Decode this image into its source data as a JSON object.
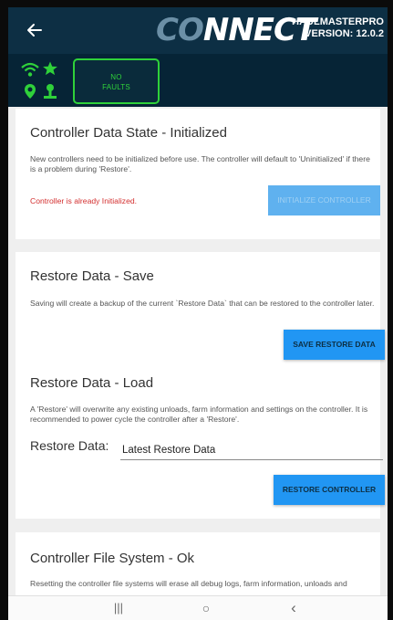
{
  "appbar": {
    "back_icon": "arrow-left-icon",
    "logo_prefix": "CO",
    "logo_suffix": "NNECT",
    "device_name": "HAULMASTERPRO",
    "version": "VERSION: 12.0.2"
  },
  "status": {
    "icons": [
      "wifi-icon",
      "star-icon",
      "location-pin-icon",
      "person-pin-icon"
    ],
    "faults_line1": "NO",
    "faults_line2": "FAULTS",
    "faults_color": "#2fd13a"
  },
  "controller_state": {
    "title": "Controller Data State - Initialized",
    "description": "New controllers need to be initialized before use. The controller will default to 'Uninitialized' if there is a problem during 'Restore'.",
    "warning": "Controller is already Initialized.",
    "button_label": "INITIALIZE CONTROLLER"
  },
  "restore_save": {
    "title": "Restore Data - Save",
    "description": "Saving will create a backup of the current `Restore Data` that can be restored to the controller later.",
    "button_label": "SAVE RESTORE DATA"
  },
  "restore_load": {
    "title": "Restore Data - Load",
    "description": "A 'Restore' will overwrite any existing unloads, farm information and settings on the controller. It is recommended to power cycle the controller after a 'Restore'.",
    "field_label": "Restore Data:",
    "field_value": "Latest Restore Data",
    "button_label": "RESTORE CONTROLLER"
  },
  "file_system": {
    "title": "Controller File System - Ok",
    "description": "Resetting the controller file systems will erase all debug logs, farm information, unloads and"
  },
  "navbar": {
    "recent_icon": "recent-apps-icon",
    "home_icon": "home-icon",
    "back_icon": "back-chevron-icon",
    "recent_glyph": "|||",
    "home_glyph": "○",
    "back_glyph": "‹"
  },
  "colors": {
    "appbar": "#0d2f44",
    "statusbar": "#062436",
    "accent": "#2196f3",
    "warning": "#d32f2f"
  }
}
